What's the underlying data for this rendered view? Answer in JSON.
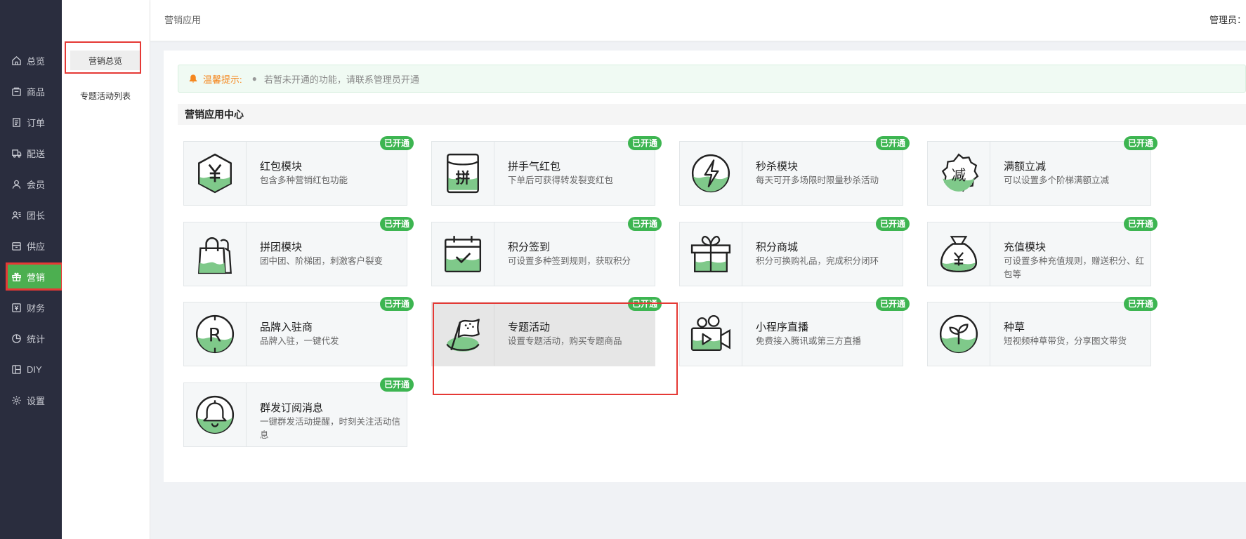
{
  "header": {
    "breadcrumb": "营销应用",
    "admin_label": "管理员："
  },
  "sidebar": {
    "items": [
      {
        "label": "总览",
        "icon": "home-icon"
      },
      {
        "label": "商品",
        "icon": "goods-icon"
      },
      {
        "label": "订单",
        "icon": "order-icon"
      },
      {
        "label": "配送",
        "icon": "delivery-icon"
      },
      {
        "label": "会员",
        "icon": "member-icon"
      },
      {
        "label": "团长",
        "icon": "leader-icon"
      },
      {
        "label": "供应",
        "icon": "supply-icon"
      },
      {
        "label": "营销",
        "icon": "gift-icon",
        "active": true
      },
      {
        "label": "财务",
        "icon": "finance-icon"
      },
      {
        "label": "统计",
        "icon": "stats-icon"
      },
      {
        "label": "DIY",
        "icon": "diy-icon"
      },
      {
        "label": "设置",
        "icon": "gear-icon"
      }
    ]
  },
  "subnav": {
    "items": [
      {
        "label": "营销总览",
        "active": true
      },
      {
        "label": "专题活动列表"
      }
    ]
  },
  "tip": {
    "label": "温馨提示:",
    "text": "若暂未开通的功能，请联系管理员开通"
  },
  "section": {
    "title": "营销应用中心"
  },
  "apps": [
    {
      "name": "红包模块",
      "desc": "包含多种营销红包功能",
      "badge": "已开通",
      "icon": "red-packet-icon"
    },
    {
      "name": "拼手气红包",
      "desc": "下单后可获得转发裂变红包",
      "badge": "已开通",
      "icon": "lucky-packet-icon"
    },
    {
      "name": "秒杀模块",
      "desc": "每天可开多场限时限量秒杀活动",
      "badge": "已开通",
      "icon": "flash-sale-icon"
    },
    {
      "name": "满额立减",
      "desc": "可以设置多个阶梯满额立减",
      "badge": "已开通",
      "icon": "discount-icon"
    },
    {
      "name": "拼团模块",
      "desc": "团中团、阶梯团，刺激客户裂变",
      "badge": "已开通",
      "icon": "group-buy-icon"
    },
    {
      "name": "积分签到",
      "desc": "可设置多种签到规则，获取积分",
      "badge": "已开通",
      "icon": "checkin-calendar-icon"
    },
    {
      "name": "积分商城",
      "desc": "积分可换购礼品，完成积分闭环",
      "badge": "已开通",
      "icon": "gift-box-icon"
    },
    {
      "name": "充值模块",
      "desc": "可设置多种充值规则，赠送积分、红包等",
      "badge": "已开通",
      "icon": "money-bag-icon"
    },
    {
      "name": "品牌入驻商",
      "desc": "品牌入驻，一键代发",
      "badge": "已开通",
      "icon": "brand-icon"
    },
    {
      "name": "专题活动",
      "desc": "设置专题活动，购买专题商品",
      "badge": "已开通",
      "icon": "flag-icon",
      "selected": true
    },
    {
      "name": "小程序直播",
      "desc": "免费接入腾讯或第三方直播",
      "badge": "已开通",
      "icon": "live-video-icon"
    },
    {
      "name": "种草",
      "desc": "短视频种草带货，分享图文带货",
      "badge": "已开通",
      "icon": "sprout-icon"
    },
    {
      "name": "群发订阅消息",
      "desc": "一键群发活动提醒，时刻关注活动信息",
      "badge": "已开通",
      "icon": "bell-icon"
    }
  ],
  "colors": {
    "accent": "#4caf50",
    "badge": "#3db551",
    "highlight": "#e53935",
    "sidebar": "#2a2d3e",
    "tip_label": "#f5871f"
  }
}
